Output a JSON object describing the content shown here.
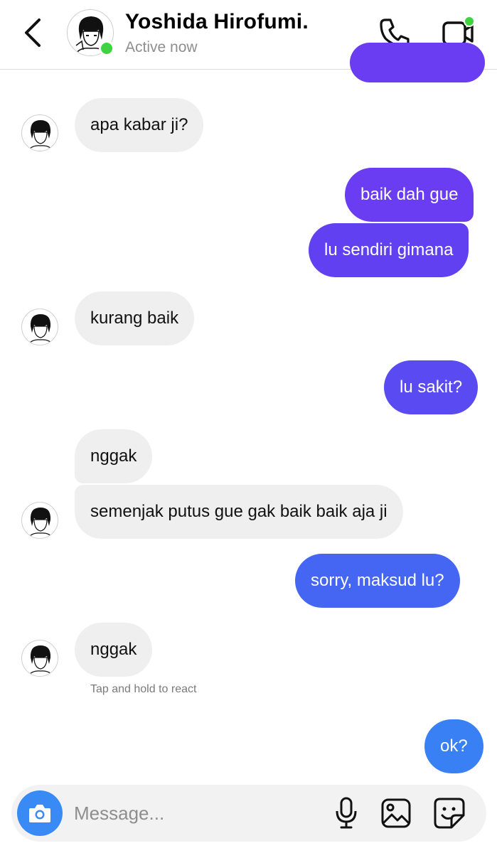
{
  "header": {
    "contact_name": "Yoshida Hirofumi.",
    "status": "Active now",
    "icons": {
      "back": "chevron-left-icon",
      "call": "phone-icon",
      "video": "video-camera-icon"
    },
    "online_color": "#3fd43f"
  },
  "messages": [
    {
      "from": "them",
      "text": "apa kabar ji?"
    },
    {
      "from": "me",
      "text": "baik dah gue"
    },
    {
      "from": "me",
      "text": "lu sendiri gimana"
    },
    {
      "from": "them",
      "text": "kurang baik"
    },
    {
      "from": "me",
      "text": "lu sakit?"
    },
    {
      "from": "them",
      "text": "nggak"
    },
    {
      "from": "them",
      "text": "semenjak putus gue gak baik baik aja ji"
    },
    {
      "from": "me",
      "text": "sorry, maksud lu?"
    },
    {
      "from": "them",
      "text": "nggak"
    },
    {
      "from": "me",
      "text": "ok?"
    }
  ],
  "react_hint": "Tap and hold to react",
  "composer": {
    "placeholder": "Message...",
    "value": "",
    "icons": {
      "camera": "camera-icon",
      "mic": "microphone-icon",
      "gallery": "image-icon",
      "sticker": "sticker-icon"
    }
  },
  "colors": {
    "bubble_in": "#efefef",
    "bubble_out_top": "#6a3df2",
    "bubble_out_mid": "#4f5bf0",
    "bubble_out_bottom": "#3a80f5",
    "camera_button": "#3a8af5"
  }
}
